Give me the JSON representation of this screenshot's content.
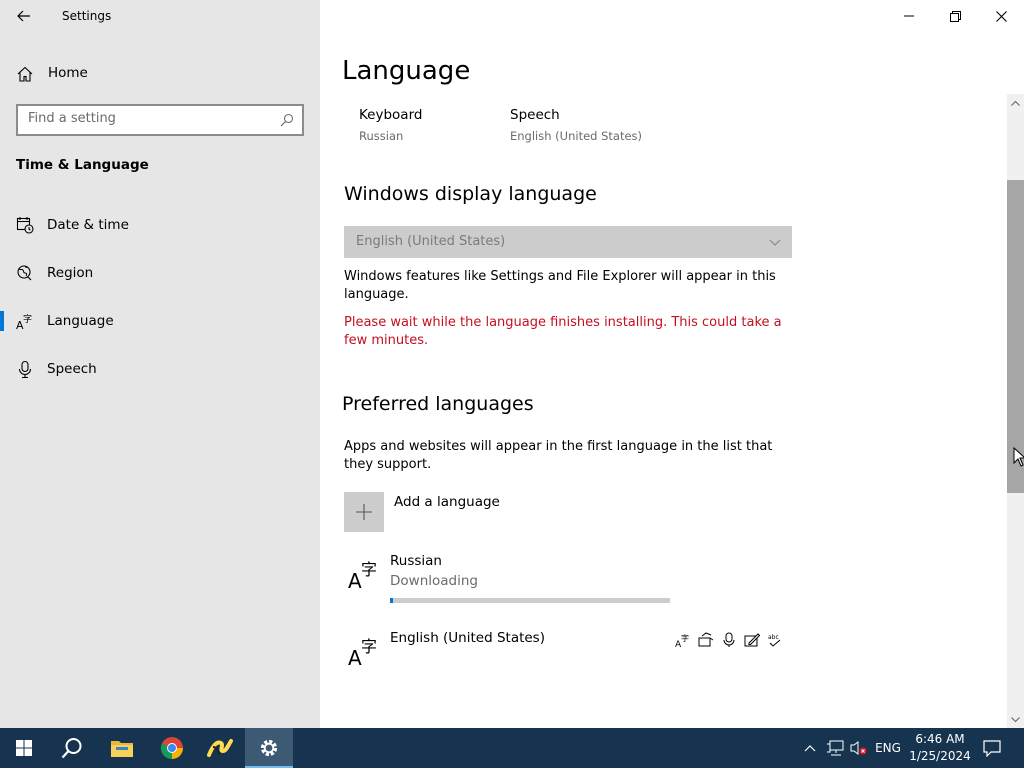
{
  "window": {
    "title": "Settings",
    "controls": {
      "minimize": "minimize",
      "maximize": "restore",
      "close": "close"
    }
  },
  "sidebar": {
    "home_label": "Home",
    "search": {
      "placeholder": "Find a setting",
      "value": ""
    },
    "section_title": "Time & Language",
    "items": [
      {
        "label": "Date & time",
        "icon": "calendar-clock-icon",
        "active": false
      },
      {
        "label": "Region",
        "icon": "globe-icon",
        "active": false
      },
      {
        "label": "Language",
        "icon": "language-icon",
        "active": true
      },
      {
        "label": "Speech",
        "icon": "microphone-icon",
        "active": false
      }
    ]
  },
  "main": {
    "title": "Language",
    "features": [
      {
        "name": "Keyboard",
        "value": "Russian"
      },
      {
        "name": "Speech",
        "value": "English (United States)"
      }
    ],
    "display_language": {
      "heading": "Windows display language",
      "selected": "English (United States)",
      "description": "Windows features like Settings and File Explorer will appear in this language.",
      "warning": "Please wait while the language finishes installing. This could take a few minutes.",
      "warning_color": "#c50f1f"
    },
    "preferred": {
      "heading": "Preferred languages",
      "description": "Apps and websites will appear in the first language in the list that they support.",
      "add_label": "Add a language",
      "languages": [
        {
          "name": "Russian",
          "status": "Downloading",
          "progress": 0.01
        },
        {
          "name": "English (United States)",
          "feature_icons": [
            "display-language-icon",
            "text-to-speech-icon",
            "speech-recognition-icon",
            "handwriting-icon",
            "spellcheck-icon"
          ]
        }
      ]
    }
  },
  "taskbar": {
    "apps": [
      "start-icon",
      "search-icon",
      "file-explorer-icon",
      "chrome-icon",
      "yandex-icon",
      "settings-icon"
    ],
    "tray": {
      "language": "ENG",
      "time": "6:46 AM",
      "date": "1/25/2024"
    }
  },
  "colors": {
    "accent": "#0078d7",
    "sidebar_bg": "#e6e6e6",
    "taskbar_bg": "#16344f"
  }
}
